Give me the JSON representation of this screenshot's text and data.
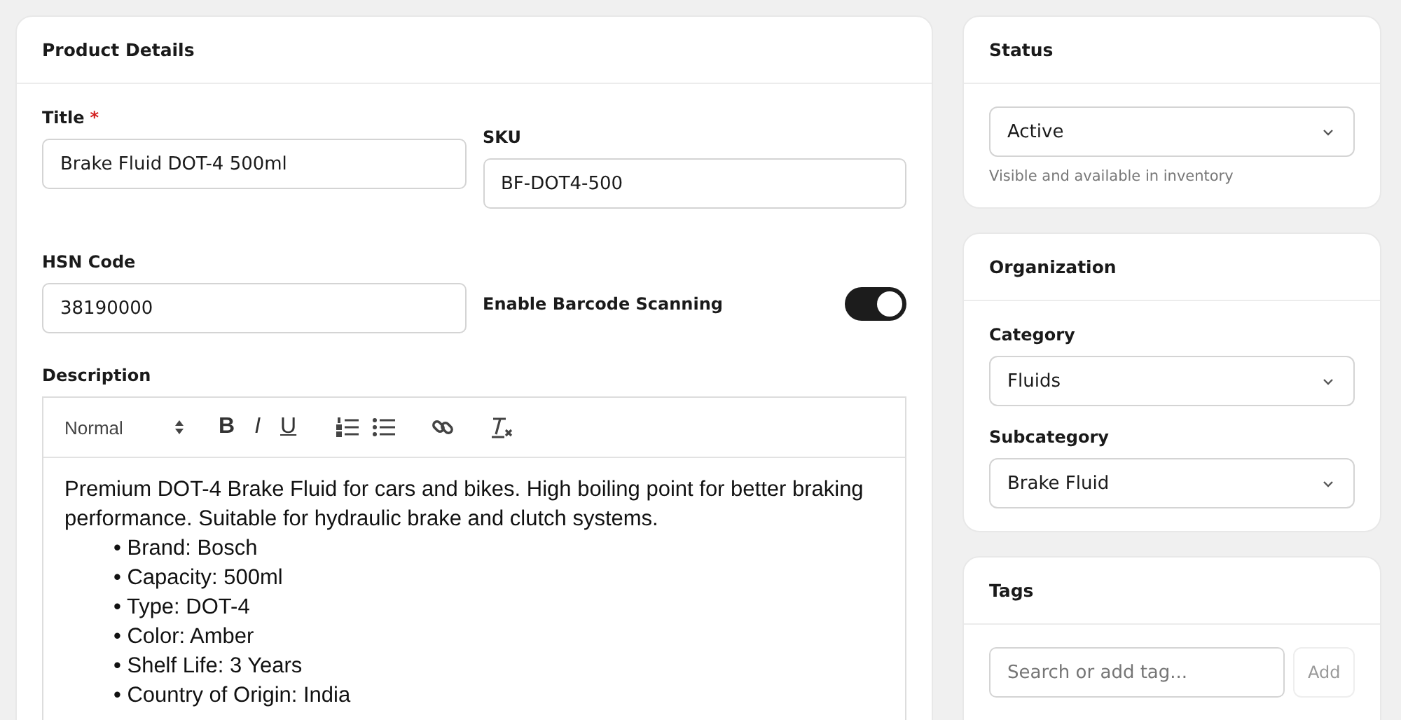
{
  "product_details": {
    "title": "Product Details",
    "title_field": {
      "label": "Title",
      "required_mark": "*",
      "value": "Brake Fluid DOT-4 500ml"
    },
    "sku_field": {
      "label": "SKU",
      "value": "BF-DOT4-500"
    },
    "hsn_field": {
      "label": "HSN Code",
      "value": "38190000"
    },
    "barcode_toggle": {
      "label": "Enable Barcode Scanning",
      "on": true
    },
    "description": {
      "label": "Description",
      "toolbar": [
        {
          "kind": "format",
          "label": "Normal"
        },
        {
          "kind": "bold",
          "label": "B"
        },
        {
          "kind": "italic",
          "label": "I"
        },
        {
          "kind": "underline",
          "label": "U"
        },
        {
          "kind": "ordered-list"
        },
        {
          "kind": "bullet-list"
        },
        {
          "kind": "link"
        },
        {
          "kind": "clean"
        }
      ],
      "paragraph": "Premium DOT-4 Brake Fluid for cars and bikes. High boiling point for better braking performance. Suitable for hydraulic brake and clutch systems.",
      "bullets": [
        "• Brand: Bosch",
        "• Capacity: 500ml",
        "• Type: DOT-4",
        "• Color: Amber",
        "• Shelf Life: 3 Years",
        "• Country of Origin: India"
      ]
    }
  },
  "status": {
    "title": "Status",
    "value": "Active",
    "hint": "Visible and available in inventory"
  },
  "organization": {
    "title": "Organization",
    "fields": [
      {
        "label": "Category",
        "value": "Fluids"
      },
      {
        "label": "Subcategory",
        "value": "Brake Fluid"
      }
    ]
  },
  "tags": {
    "title": "Tags",
    "placeholder": "Search or add tag...",
    "button": "Add"
  }
}
